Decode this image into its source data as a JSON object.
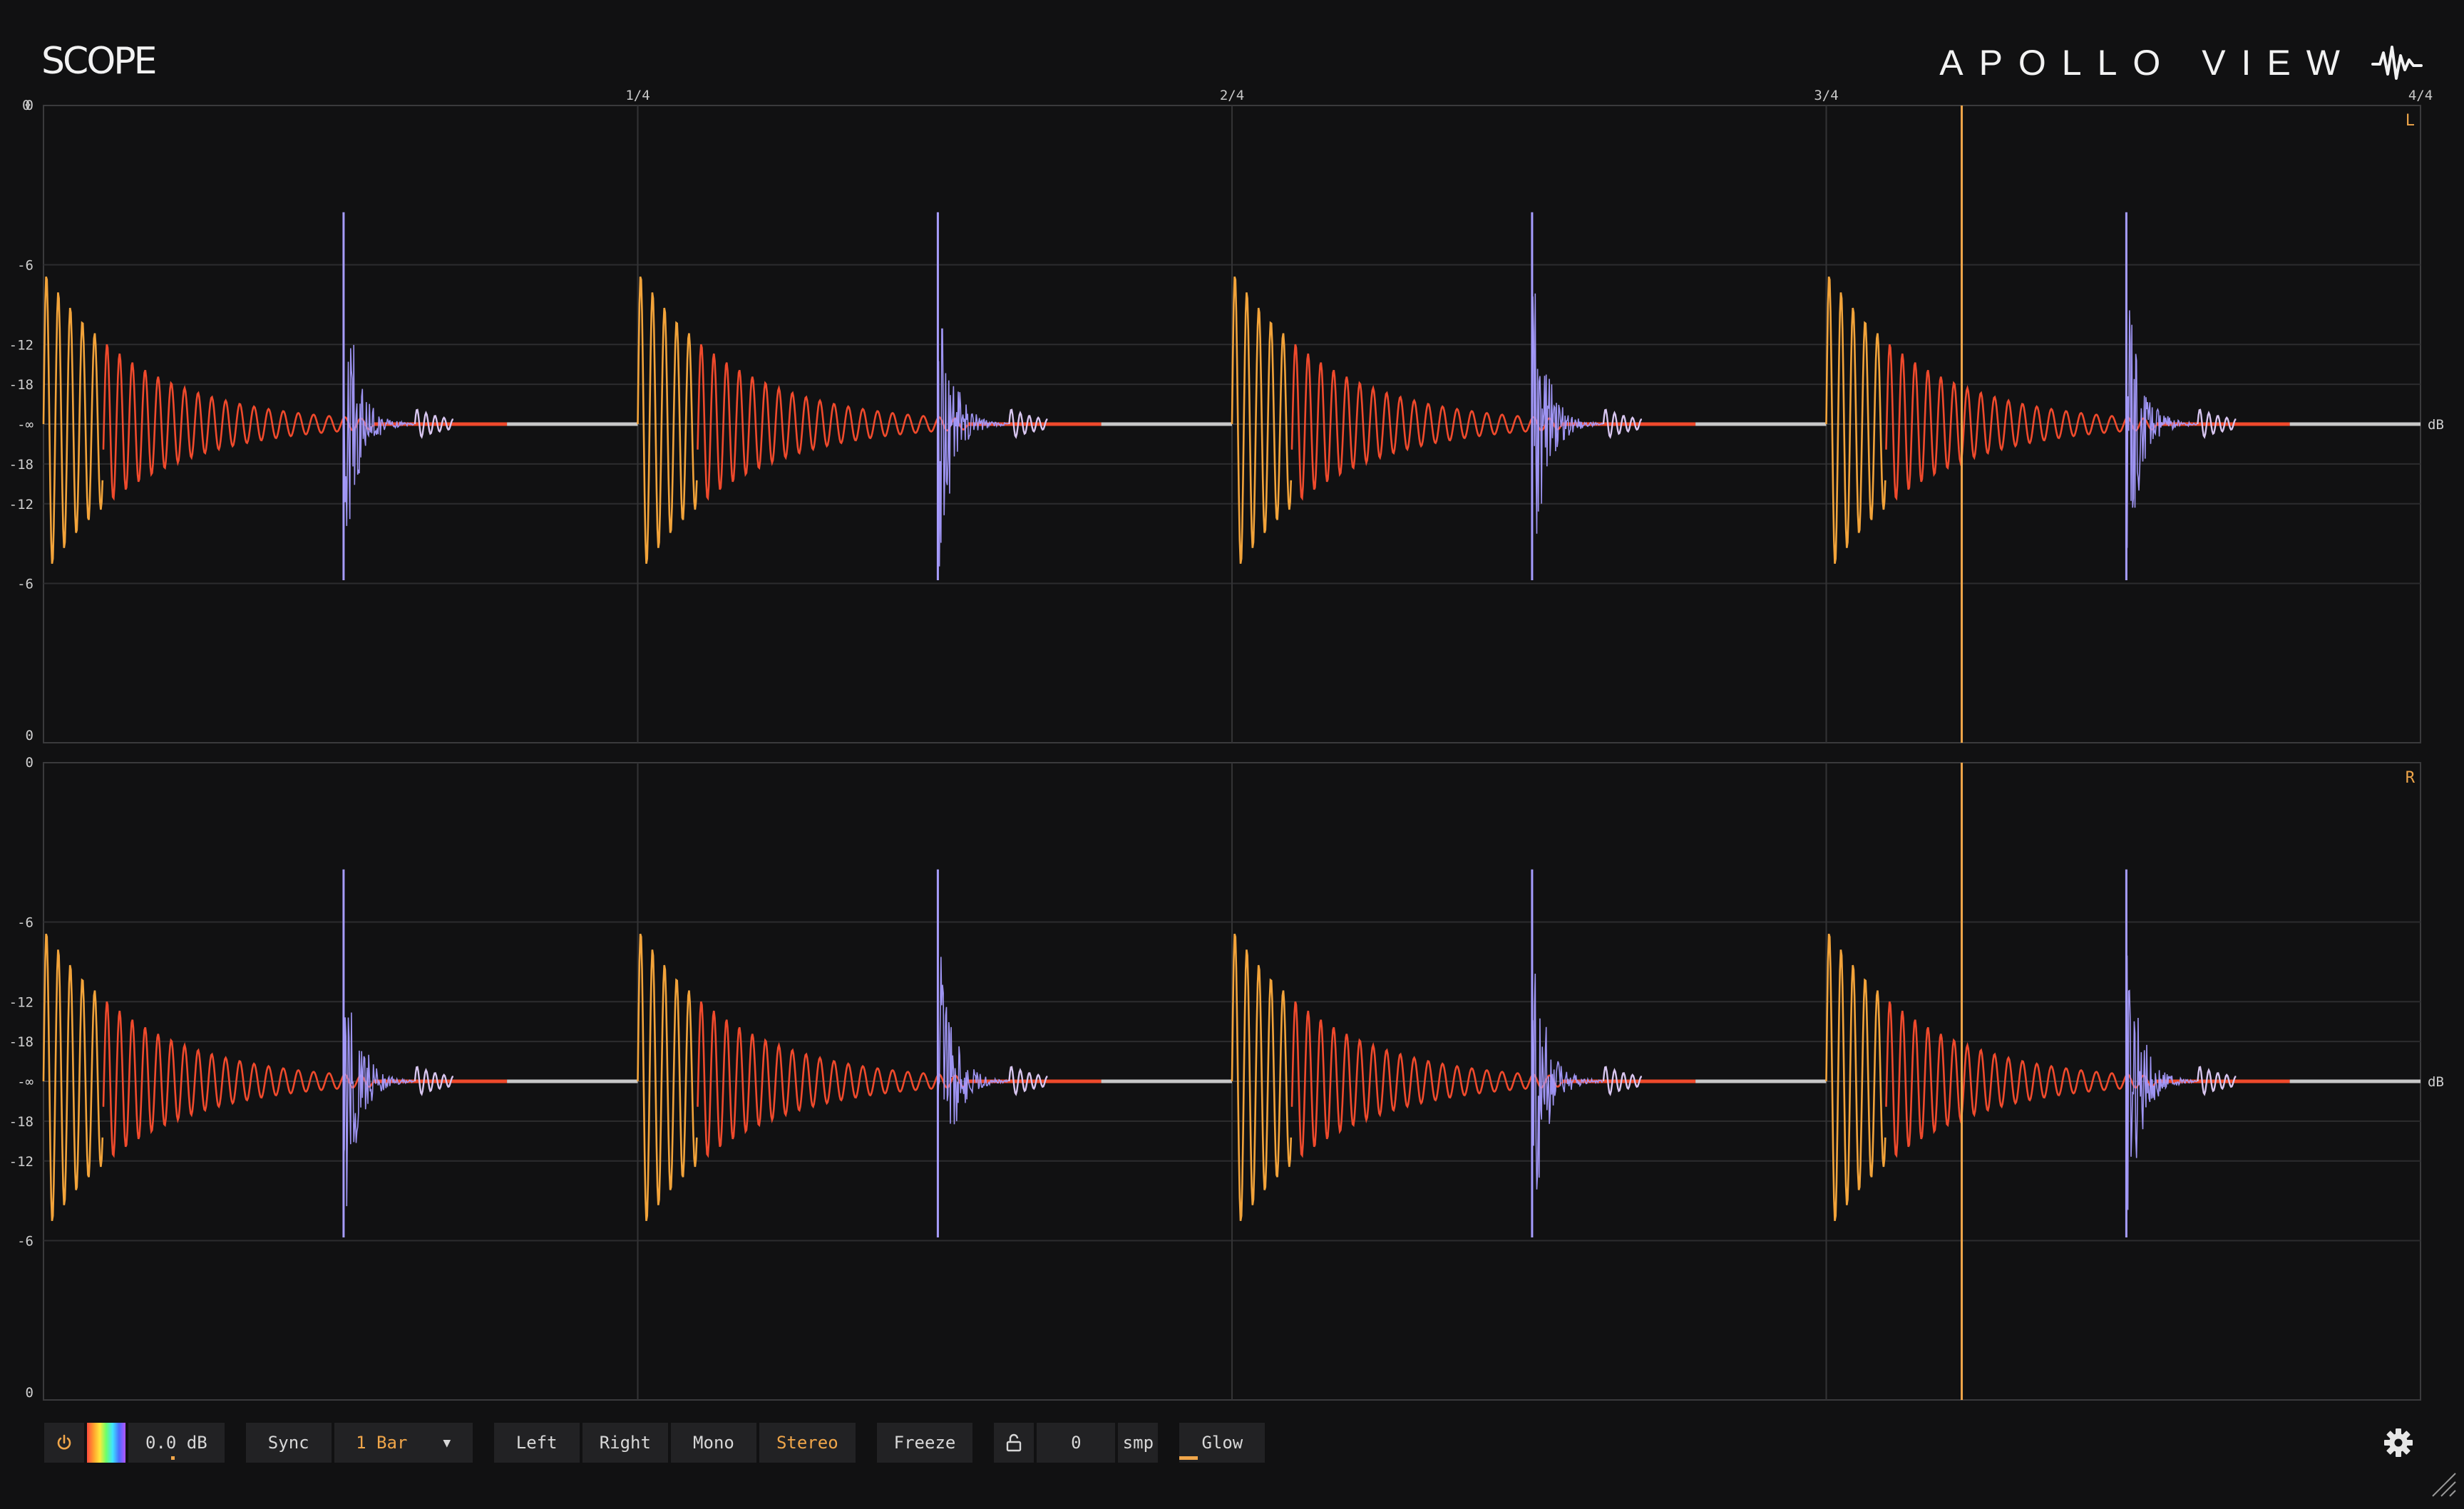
{
  "app": {
    "logo": "SCOPE",
    "brand": "APOLLO VIEW"
  },
  "timeline": {
    "start": "0",
    "markers": [
      "1/4",
      "2/4",
      "3/4",
      "4/4"
    ]
  },
  "channels": [
    {
      "label": "L",
      "unit": "dB",
      "db_scale": [
        "0",
        "-6",
        "-12",
        "-18",
        "-∞",
        "-18",
        "-12",
        "-6",
        "0"
      ]
    },
    {
      "label": "R",
      "unit": "dB",
      "db_scale": [
        "0",
        "-6",
        "-12",
        "-18",
        "-∞",
        "-18",
        "-12",
        "-6",
        "0"
      ]
    }
  ],
  "waveform": {
    "beats_shown": 4,
    "hits_per_beat": [
      "kick",
      "snare"
    ],
    "playhead_fraction_of_bar": 0.807,
    "colors": {
      "kick_attack": "#f2a33a",
      "kick_tail": "#f04a2c",
      "snare": "#a69cff",
      "silence": "#c8c8c8",
      "playhead": "#f0a64a"
    }
  },
  "toolbar": {
    "gain": "0.0 dB",
    "sync_label": "Sync",
    "sync_value": "1 Bar",
    "channel_modes": [
      "Left",
      "Right",
      "Mono",
      "Stereo"
    ],
    "active_mode": "Stereo",
    "freeze": "Freeze",
    "offset_value": "0",
    "offset_unit": "smp",
    "glow": "Glow"
  },
  "colors": {
    "accent": "#f0a64a",
    "background": "#111112",
    "panel": "#222224"
  },
  "icons": [
    "power-icon",
    "color-spectrum-icon",
    "dropdown-caret-icon",
    "unlock-icon",
    "gear-icon",
    "resize-grip-icon",
    "waveform-logo-icon"
  ]
}
